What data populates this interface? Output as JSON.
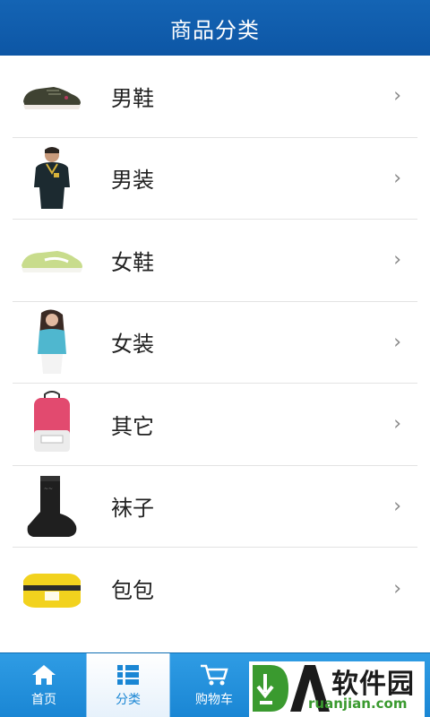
{
  "header": {
    "title": "商品分类"
  },
  "categories": [
    {
      "label": "男鞋"
    },
    {
      "label": "男装"
    },
    {
      "label": "女鞋"
    },
    {
      "label": "女装"
    },
    {
      "label": "其它"
    },
    {
      "label": "袜子"
    },
    {
      "label": "包包"
    }
  ],
  "chevron": "›",
  "tabbar": {
    "tabs": [
      {
        "label": "首页",
        "icon": "home-icon"
      },
      {
        "label": "分类",
        "icon": "grid-list-icon",
        "active": true
      },
      {
        "label": "购物车",
        "icon": "cart-icon"
      }
    ]
  },
  "watermark": {
    "text": "软件园",
    "url": "ruanjian.com"
  },
  "colors": {
    "header": "#0d56a5",
    "tabbar": "#1a86d4",
    "accent_green": "#3a9a2f"
  }
}
